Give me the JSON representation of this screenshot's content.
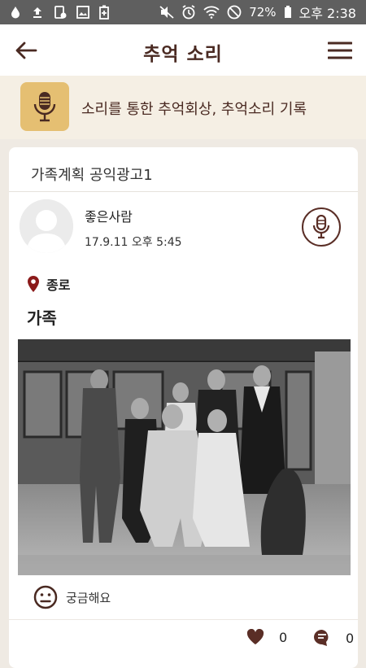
{
  "status_bar": {
    "battery": "72%",
    "time": "오후 2:38",
    "left_icons": [
      "water-drop-icon",
      "upload-icon",
      "download-icon",
      "image-icon",
      "battery-saver-icon"
    ],
    "right_icons": [
      "mute-icon",
      "alarm-icon",
      "wifi-icon",
      "do-not-disturb-icon",
      "battery-icon"
    ]
  },
  "app_bar": {
    "title": "추억 소리",
    "back_icon": "arrow-left-icon",
    "menu_icon": "hamburger-menu-icon"
  },
  "banner": {
    "text": "소리를 통한 추억회상, 추억소리 기록",
    "icon": "microphone-icon",
    "icon_bg": "#e5bf72"
  },
  "post": {
    "title": "가족계획 공익광고1",
    "author": "좋은사람",
    "date": "17.9.11 오후 5:45",
    "location": "종로",
    "text": "가족",
    "photo": "black-and-white family portrait photo",
    "reaction_label": "궁금해요",
    "like_count": "0",
    "comment_count": "0"
  },
  "colors": {
    "accent": "#5a2e26",
    "title_text": "#4a2a22",
    "background": "#efeae3",
    "location_pin": "#8b1a1a"
  }
}
